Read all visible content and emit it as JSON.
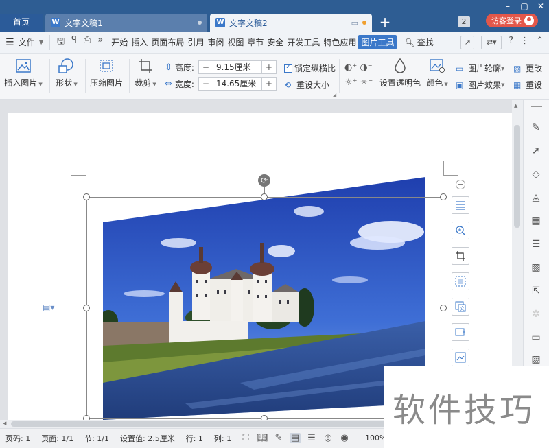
{
  "titlebar": {
    "home_tab": "首页",
    "doc_tabs": [
      {
        "name": "文字文稿1"
      },
      {
        "name": "文字文稿2"
      }
    ],
    "badge_count": "2",
    "login_label": "访客登录"
  },
  "menu": {
    "file_label": "文件",
    "items": [
      "开始",
      "插入",
      "页面布局",
      "引用",
      "审阅",
      "视图",
      "章节",
      "安全",
      "开发工具",
      "特色应用",
      "图片工具"
    ],
    "active_item": "图片工具",
    "search_label": "查找",
    "help_label": "?"
  },
  "ribbon": {
    "insert_picture": "插入图片",
    "shape": "形状",
    "compress": "压缩图片",
    "crop": "裁剪",
    "height_label": "高度:",
    "height_value": "9.15厘米",
    "width_label": "宽度:",
    "width_value": "14.65厘米",
    "lock_ratio": "锁定纵横比",
    "reset_size": "重设大小",
    "set_transparent": "设置透明色",
    "color": "颜色",
    "picture_outline": "图片轮廓",
    "picture_effect": "图片效果",
    "more_1": "更改",
    "more_2": "重设",
    "minus": "−",
    "plus": "+"
  },
  "statusbar": {
    "page_code": "页码: 1",
    "page": "页面: 1/1",
    "section": "节: 1/1",
    "setting": "设置值: 2.5厘米",
    "row": "行: 1",
    "col": "列: 1",
    "zoom": "100%"
  },
  "watermark": "软件技巧",
  "colors": {
    "title_bar": "#2e5d93",
    "accent": "#3b78c9",
    "login_button": "#e3574a"
  }
}
